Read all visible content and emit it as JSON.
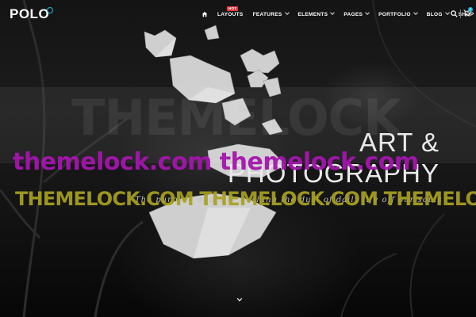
{
  "header": {
    "logo": "POLO",
    "nav": [
      {
        "label": "LAYOUTS",
        "badge": "HOT",
        "has_dropdown": false
      },
      {
        "label": "FEATURES",
        "has_dropdown": true
      },
      {
        "label": "ELEMENTS",
        "has_dropdown": true
      },
      {
        "label": "PAGES",
        "has_dropdown": true
      },
      {
        "label": "PORTFOLIO",
        "has_dropdown": true
      },
      {
        "label": "BLOG",
        "has_dropdown": true
      },
      {
        "label": "SHOP",
        "has_dropdown": true
      }
    ],
    "icons": {
      "home": "home-icon",
      "search": "search-icon",
      "cart": "shopping-cart-icon"
    },
    "cart_count": "0"
  },
  "hero": {
    "title_line1": "ART &",
    "title_line2": "PHOTOGRAPHY",
    "tagline": "The purpose of art is washing the dust of daily life off our souls",
    "scroll_icon": "chevron-down-icon"
  },
  "watermarks": {
    "back": "THEMELOCK",
    "magenta": "themelock.com themelock.com",
    "yellow": "THEMELOCK.COM THEMELOCK.COM THEMELOCK.COM"
  },
  "colors": {
    "accent": "#26b8d9",
    "hot_badge": "#e23a3a",
    "watermark_magenta": "#a515ae",
    "watermark_yellow": "#a8a11f"
  }
}
